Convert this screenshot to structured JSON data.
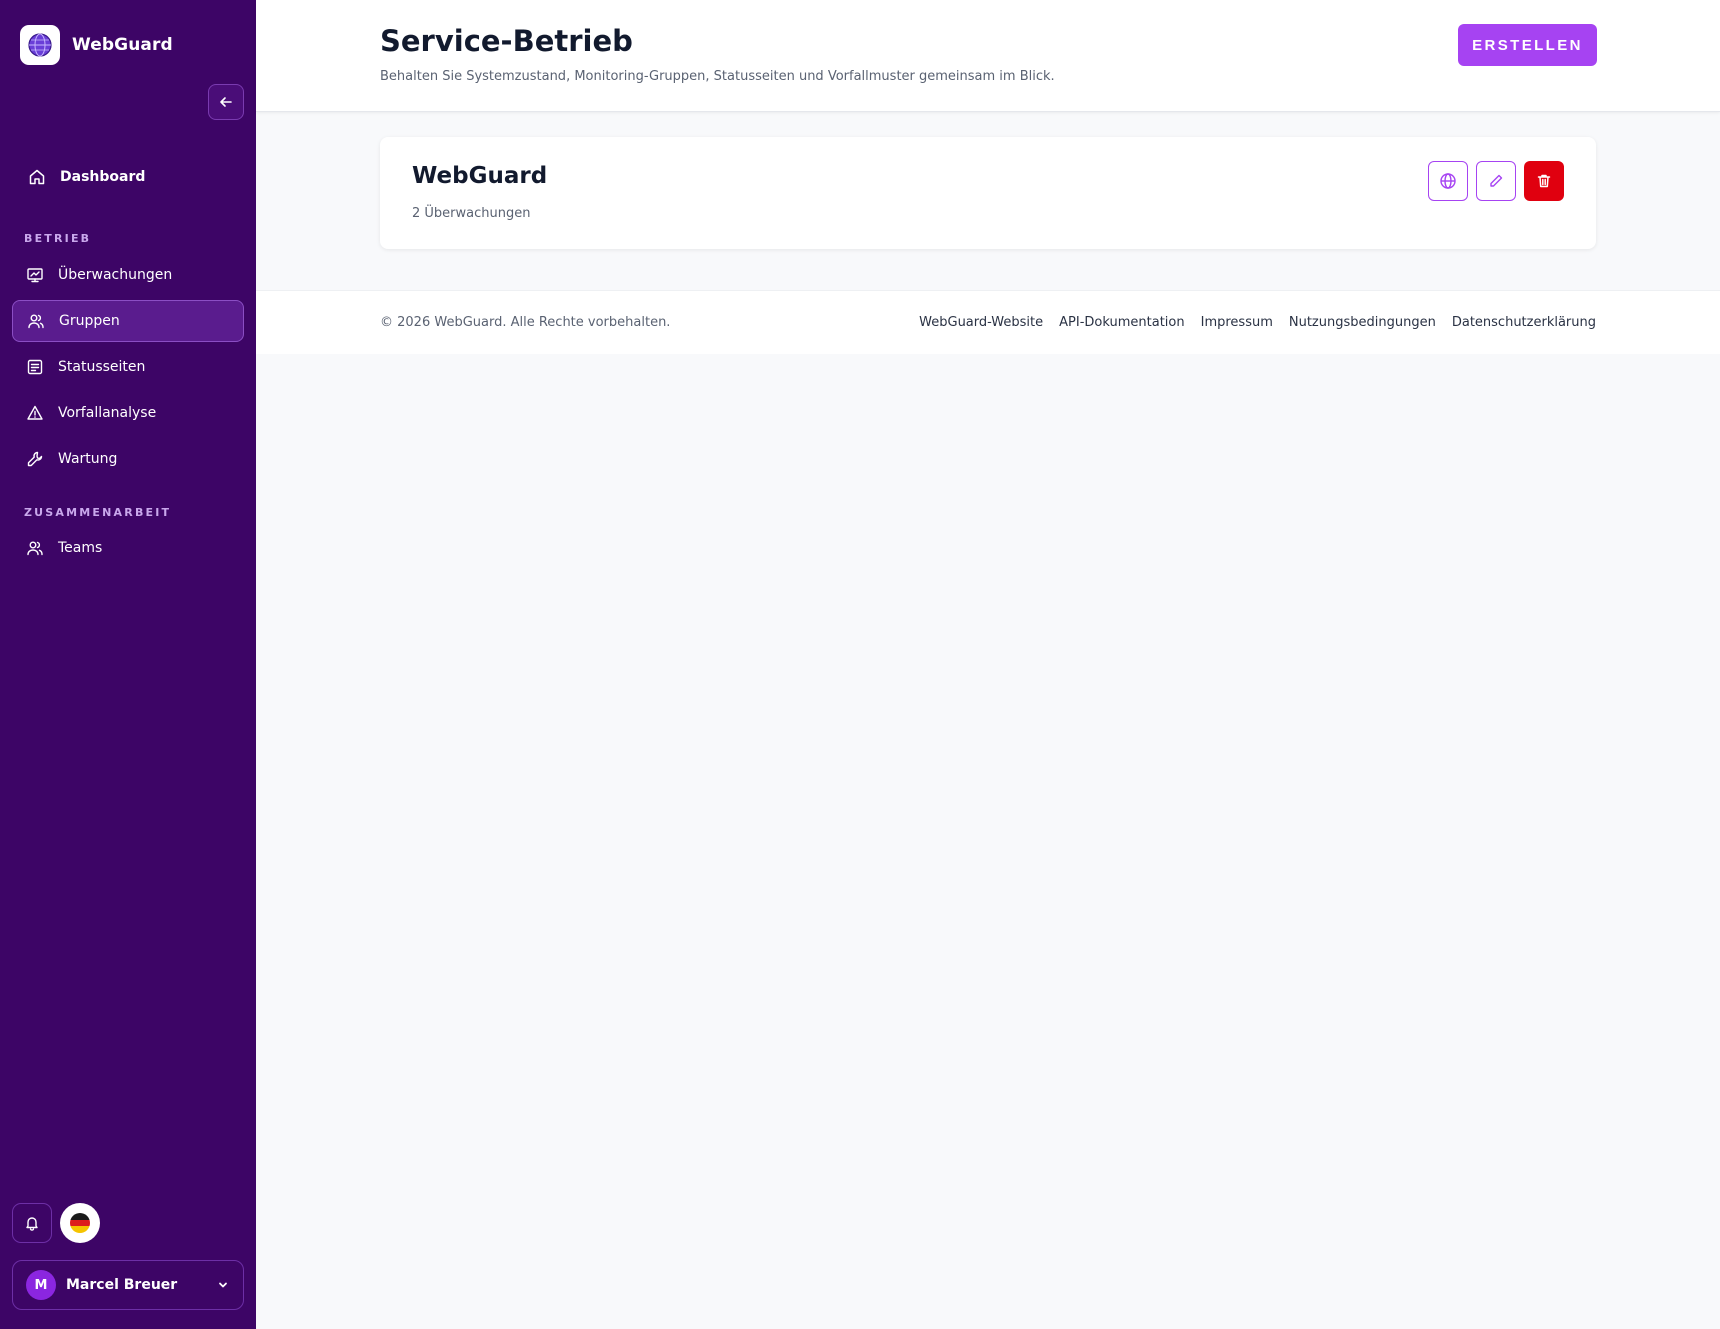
{
  "brand": {
    "name": "WebGuard"
  },
  "sidebar": {
    "dashboard": "Dashboard",
    "section_operations": "BETRIEB",
    "items": [
      {
        "label": "Überwachungen",
        "icon": "chart-monitor-icon"
      },
      {
        "label": "Gruppen",
        "icon": "users-icon",
        "active": true
      },
      {
        "label": "Statusseiten",
        "icon": "document-icon"
      },
      {
        "label": "Vorfallanalyse",
        "icon": "warning-icon"
      },
      {
        "label": "Wartung",
        "icon": "wrench-icon"
      }
    ],
    "section_collab": "ZUSAMMENARBEIT",
    "teams": "Teams",
    "user": {
      "initial": "M",
      "name": "Marcel Breuer"
    }
  },
  "header": {
    "title": "Service-Betrieb",
    "subtitle": "Behalten Sie Systemzustand, Monitoring-Gruppen, Statusseiten und Vorfallmuster gemeinsam im Blick.",
    "create_label": "ERSTELLEN"
  },
  "group_card": {
    "title": "WebGuard",
    "subtitle": "2 Überwachungen"
  },
  "footer": {
    "copyright": "© 2026 WebGuard. Alle Rechte vorbehalten.",
    "links": [
      "WebGuard-Website",
      "API-Dokumentation",
      "Impressum",
      "Nutzungsbedingungen",
      "Datenschutzerklärung"
    ]
  },
  "colors": {
    "sidebar_bg": "#3d0566",
    "accent": "#a643f2",
    "danger": "#e0000f"
  }
}
